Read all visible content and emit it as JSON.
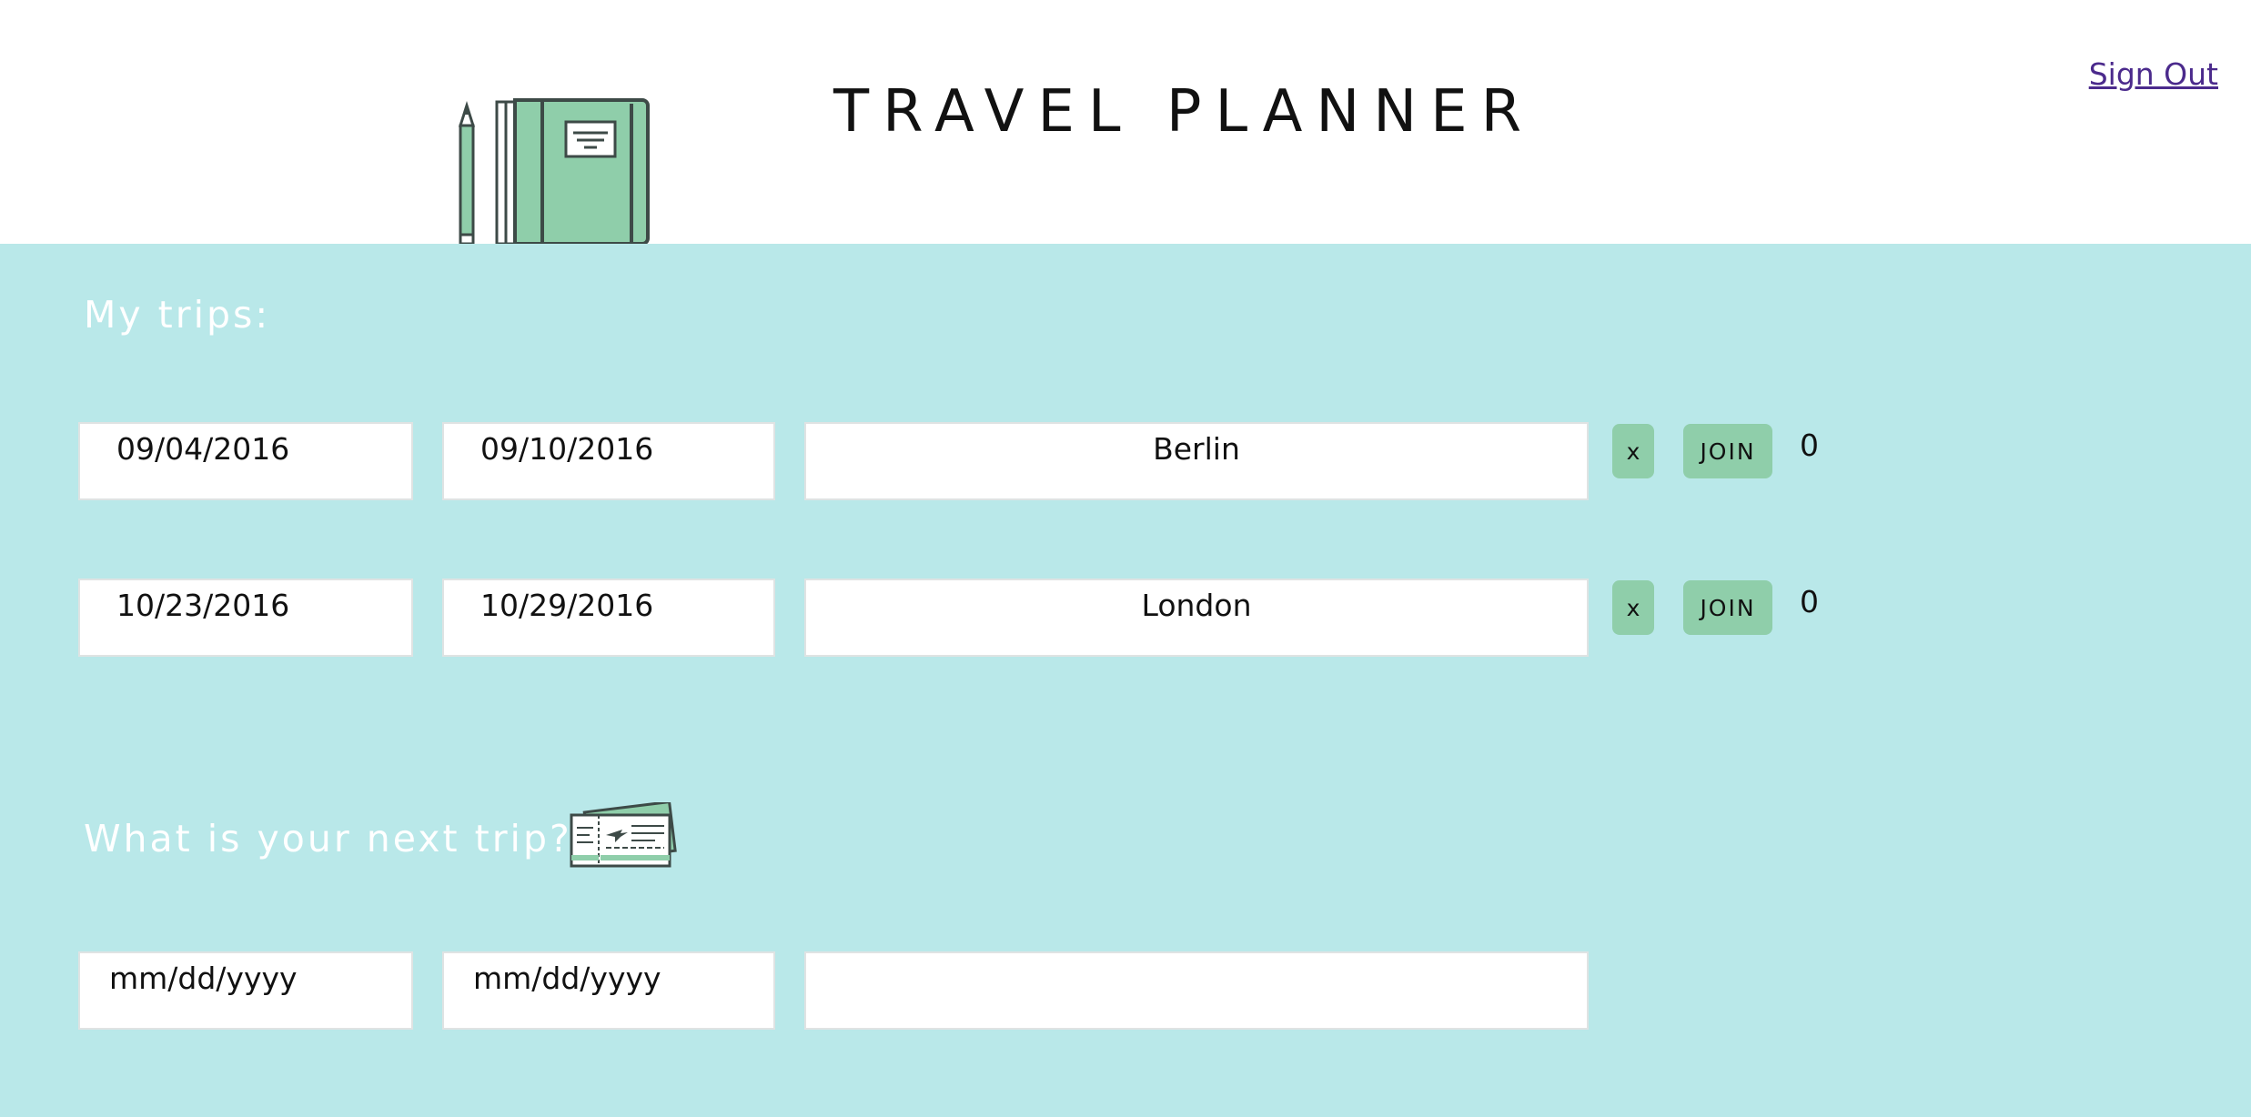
{
  "header": {
    "title": "TRAVEL PLANNER",
    "logo_icon": "notebook-pencil-icon",
    "signout_label": "Sign Out"
  },
  "my_trips": {
    "heading": "My trips:",
    "trips": [
      {
        "start_date": "09/04/2016",
        "end_date": "09/10/2016",
        "destination": "Berlin",
        "delete_label": "x",
        "join_label": "JOIN",
        "count": "0"
      },
      {
        "start_date": "10/23/2016",
        "end_date": "10/29/2016",
        "destination": "London",
        "delete_label": "x",
        "join_label": "JOIN",
        "count": "0"
      }
    ]
  },
  "new_trip": {
    "heading": "What is your next trip?",
    "icon": "plane-tickets-icon",
    "start_placeholder": "mm/dd/yyyy",
    "end_placeholder": "mm/dd/yyyy",
    "destination_value": ""
  },
  "colors": {
    "main_background": "#b9e8e9",
    "button_green": "#8fceaa",
    "link_purple": "#4b2a8c"
  }
}
